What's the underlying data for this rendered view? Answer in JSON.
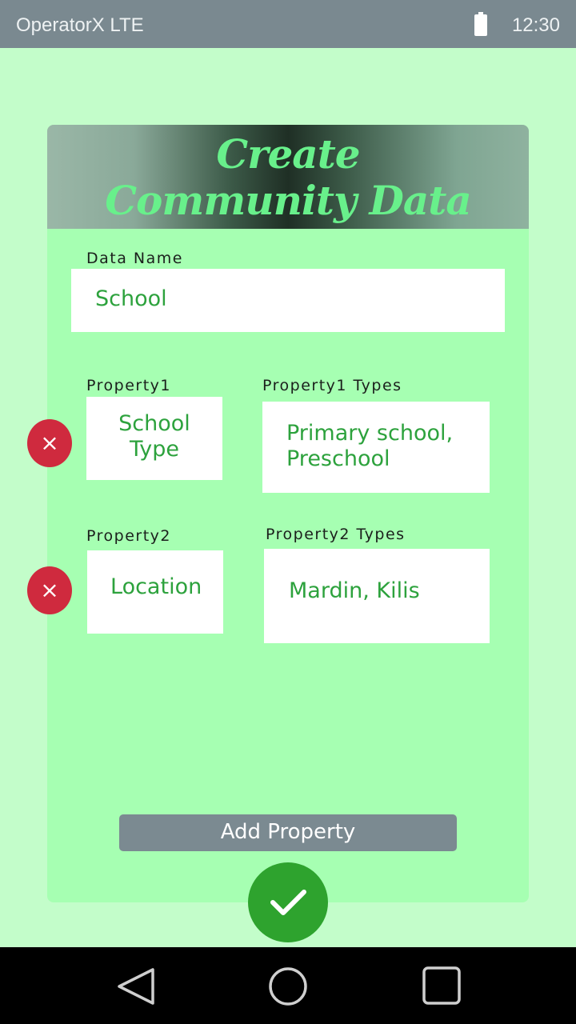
{
  "status_bar": {
    "carrier": "OperatorX LTE",
    "time": "12:30",
    "battery_icon": "battery-icon"
  },
  "card": {
    "title_line1": "Create",
    "title_line2": "Community Data",
    "data_name": {
      "label": "Data Name",
      "value": "School"
    },
    "properties": [
      {
        "label": "Property1",
        "value_line1": "School",
        "value_line2": "Type",
        "types_label": "Property1 Types",
        "types_line1": "Primary school,",
        "types_line2": "Preschool"
      },
      {
        "label": "Property2",
        "value_line1": "Location",
        "types_label": "Property2 Types",
        "types_line1": "Mardin, Kilis"
      }
    ],
    "remove_symbol": "×",
    "add_property_label": "Add Property"
  },
  "nav": {
    "back_icon": "back-triangle-icon",
    "home_icon": "home-circle-icon",
    "recents_icon": "recents-square-icon"
  },
  "colors": {
    "background": "#c3fdca",
    "card": "#a6ffb2",
    "accent_green": "#2ea32e",
    "text_green": "#2da23d",
    "remove_red": "#cf2a3e",
    "status_bar": "#7a8990"
  }
}
